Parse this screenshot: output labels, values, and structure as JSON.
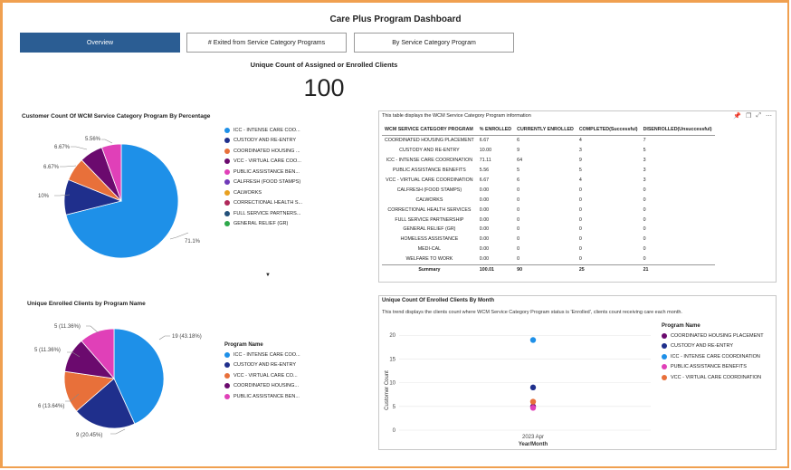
{
  "title": "Care Plus Program Dashboard",
  "tabs": [
    {
      "label": "Overview",
      "active": true
    },
    {
      "label": "# Exited from Service Category Programs"
    },
    {
      "label": "By Service Category Program"
    }
  ],
  "kpi": {
    "label": "Unique Count of Assigned or Enrolled Clients",
    "value": "100"
  },
  "pie1": {
    "title": "Customer Count Of WCM Service Category Program By Percentage",
    "slice_labels": [
      "71.1%",
      "10%",
      "6.67%",
      "6.67%",
      "5.56%"
    ],
    "legend": [
      {
        "label": "ICC - INTENSE CARE COO...",
        "color": "#1e90e8"
      },
      {
        "label": "CUSTODY AND RE-ENTRY",
        "color": "#1f2f8c"
      },
      {
        "label": "COORDINATED HOUSING ...",
        "color": "#e8703a"
      },
      {
        "label": "VCC - VIRTUAL CARE COO...",
        "color": "#6b0a6e"
      },
      {
        "label": "PUBLIC ASSISTANCE BEN...",
        "color": "#e040b8"
      },
      {
        "label": "CALFRESH (FOOD STAMPS)",
        "color": "#6f3ab8"
      },
      {
        "label": "CALWORKS",
        "color": "#e8a020"
      },
      {
        "label": "CORRECTIONAL HEALTH S...",
        "color": "#b0285a"
      },
      {
        "label": "FULL SERVICE PARTNERS...",
        "color": "#23507a"
      },
      {
        "label": "GENERAL RELIEF (GR)",
        "color": "#2ea84a"
      }
    ],
    "more_arrow": "▼"
  },
  "pie2": {
    "title": "Unique Enrolled Clients by Program Name",
    "slice_labels": [
      "19 (43.18%)",
      "9 (20.45%)",
      "6 (13.64%)",
      "5 (11.36%)",
      "5 (11.36%)"
    ],
    "legend_title": "Program Name",
    "legend": [
      {
        "label": "ICC - INTENSE CARE COO...",
        "color": "#1e90e8"
      },
      {
        "label": "CUSTODY AND RE-ENTRY",
        "color": "#1f2f8c"
      },
      {
        "label": "VCC - VIRTUAL CARE CO...",
        "color": "#e8703a"
      },
      {
        "label": "COORDINATED HOUSING...",
        "color": "#6b0a6e"
      },
      {
        "label": "PUBLIC ASSISTANCE BEN...",
        "color": "#e040b8"
      }
    ]
  },
  "table": {
    "caption": "This table displays the WCM Service Category Program information",
    "columns": [
      "WCM SERVICE CATEGORY PROGRAM",
      "% ENROLLED",
      "CURRENTLY ENROLLED",
      "COMPLETED(Successful)",
      "DISENROLLED(Unsuccessful)"
    ],
    "rows": [
      [
        "COORDINATED HOUSING PLACEMENT",
        "6.67",
        "6",
        "4",
        "7"
      ],
      [
        "CUSTODY AND RE-ENTRY",
        "10.00",
        "9",
        "3",
        "5"
      ],
      [
        "ICC - INTENSE CARE COORDINATION",
        "71.11",
        "64",
        "9",
        "3"
      ],
      [
        "PUBLIC ASSISTANCE BENEFITS",
        "5.56",
        "5",
        "5",
        "3"
      ],
      [
        "VCC - VIRTUAL CARE COORDINATION",
        "6.67",
        "6",
        "4",
        "3"
      ],
      [
        "CALFRESH (FOOD STAMPS)",
        "0.00",
        "0",
        "0",
        "0"
      ],
      [
        "CALWORKS",
        "0.00",
        "0",
        "0",
        "0"
      ],
      [
        "CORRECTIONAL HEALTH SERVICES",
        "0.00",
        "0",
        "0",
        "0"
      ],
      [
        "FULL SERVICE PARTNERSHIP",
        "0.00",
        "0",
        "0",
        "0"
      ],
      [
        "GENERAL RELIEF (GR)",
        "0.00",
        "0",
        "0",
        "0"
      ],
      [
        "HOMELESS ASSISTANCE",
        "0.00",
        "0",
        "0",
        "0"
      ],
      [
        "MEDI-CAL",
        "0.00",
        "0",
        "0",
        "0"
      ],
      [
        "WELFARE TO WORK",
        "0.00",
        "0",
        "0",
        "0"
      ]
    ],
    "summary": [
      "Summary",
      "100.01",
      "90",
      "25",
      "21"
    ],
    "icons": [
      "pin-icon",
      "copy-icon",
      "expand-icon",
      "more-icon"
    ]
  },
  "scatter": {
    "title": "Unique Count Of Enrolled Clients By Month",
    "subtitle": "This trend displays the clients count where WCM Service Category Program status is 'Enrolled', clients count receiving care each month.",
    "ylabel": "Customer Count",
    "xlabel": "Year/Month",
    "x_tick": "2023 Apr",
    "y_ticks": [
      "20",
      "15",
      "10",
      "5",
      "0"
    ],
    "legend_title": "Program Name",
    "legend": [
      {
        "label": "COORDINATED HOUSING PLACEMENT",
        "color": "#6b0a6e"
      },
      {
        "label": "CUSTODY AND RE-ENTRY",
        "color": "#1f2f8c"
      },
      {
        "label": "ICC - INTENSE CARE COORDINATION",
        "color": "#1e90e8"
      },
      {
        "label": "PUBLIC ASSISTANCE BENEFITS",
        "color": "#e040b8"
      },
      {
        "label": "VCC - VIRTUAL CARE COORDINATION",
        "color": "#e8703a"
      }
    ]
  },
  "chart_data": [
    {
      "type": "pie",
      "title": "Customer Count Of WCM Service Category Program By Percentage",
      "categories": [
        "ICC - INTENSE CARE COORDINATION",
        "CUSTODY AND RE-ENTRY",
        "COORDINATED HOUSING PLACEMENT",
        "VCC - VIRTUAL CARE COORDINATION",
        "PUBLIC ASSISTANCE BENEFITS"
      ],
      "values": [
        71.1,
        10,
        6.67,
        6.67,
        5.56
      ],
      "colors": [
        "#1e90e8",
        "#1f2f8c",
        "#e8703a",
        "#6b0a6e",
        "#e040b8"
      ]
    },
    {
      "type": "pie",
      "title": "Unique Enrolled Clients by Program Name",
      "categories": [
        "ICC - INTENSE CARE COORDINATION",
        "CUSTODY AND RE-ENTRY",
        "VCC - VIRTUAL CARE COORDINATION",
        "COORDINATED HOUSING PLACEMENT",
        "PUBLIC ASSISTANCE BENEFITS"
      ],
      "values": [
        19,
        9,
        6,
        5,
        5
      ],
      "colors": [
        "#1e90e8",
        "#1f2f8c",
        "#e8703a",
        "#6b0a6e",
        "#e040b8"
      ]
    },
    {
      "type": "scatter",
      "title": "Unique Count Of Enrolled Clients By Month",
      "xlabel": "Year/Month",
      "ylabel": "Customer Count",
      "ylim": [
        0,
        21
      ],
      "categories": [
        "2023 Apr"
      ],
      "series": [
        {
          "name": "COORDINATED HOUSING PLACEMENT",
          "values": [
            5
          ]
        },
        {
          "name": "CUSTODY AND RE-ENTRY",
          "values": [
            9
          ]
        },
        {
          "name": "ICC - INTENSE CARE COORDINATION",
          "values": [
            19
          ]
        },
        {
          "name": "PUBLIC ASSISTANCE BENEFITS",
          "values": [
            5
          ]
        },
        {
          "name": "VCC - VIRTUAL CARE COORDINATION",
          "values": [
            6
          ]
        }
      ],
      "colors": [
        "#6b0a6e",
        "#1f2f8c",
        "#1e90e8",
        "#e040b8",
        "#e8703a"
      ]
    }
  ]
}
